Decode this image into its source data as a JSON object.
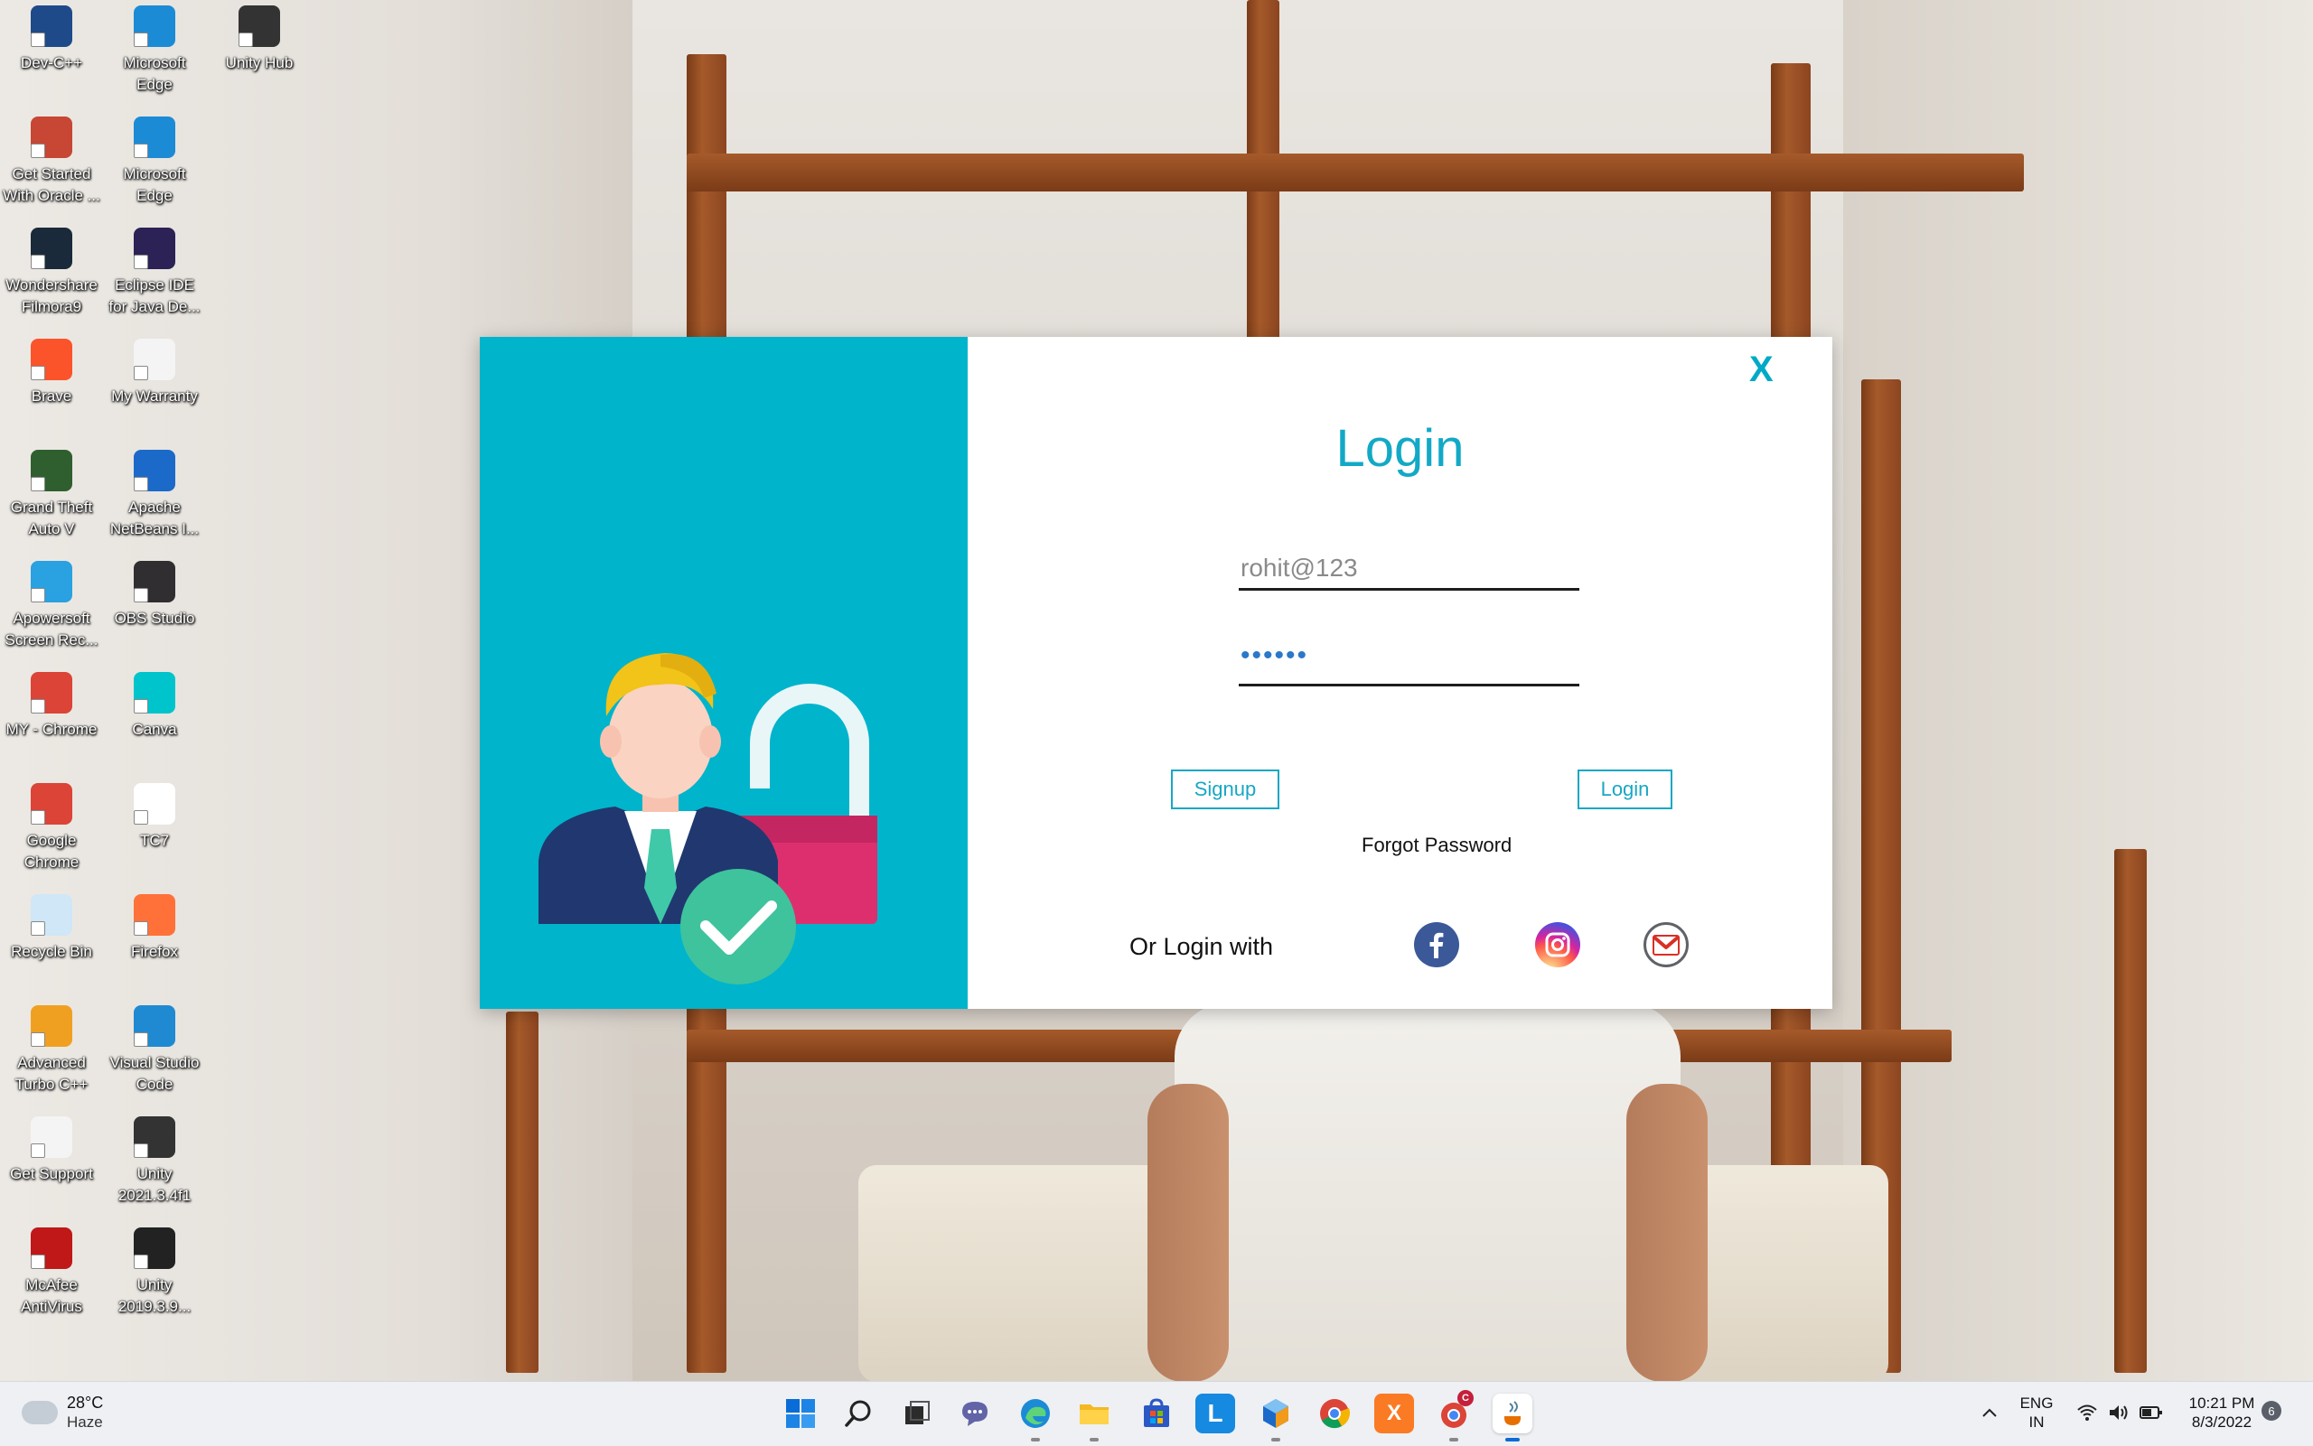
{
  "desktop": {
    "icons": [
      {
        "label": "Dev-C++",
        "icon": "devcpp-icon",
        "color": "#1f4a8a"
      },
      {
        "label": "Microsoft Edge",
        "icon": "edge-icon",
        "color": "#1b8bd6"
      },
      {
        "label": "Unity Hub",
        "icon": "unity-hub-icon",
        "color": "#333333"
      },
      {
        "label": "Get Started With Oracle ...",
        "icon": "oracle-db-icon",
        "color": "#c74634"
      },
      {
        "label": "Microsoft Edge",
        "icon": "edge-icon",
        "color": "#1b8bd6"
      },
      {
        "label": "Wondershare Filmora9",
        "icon": "filmora-icon",
        "color": "#1b2a3a"
      },
      {
        "label": "Eclipse IDE for Java De...",
        "icon": "eclipse-icon",
        "color": "#2c2255"
      },
      {
        "label": "Brave",
        "icon": "brave-icon",
        "color": "#fb542b"
      },
      {
        "label": "My Warranty",
        "icon": "document-icon",
        "color": "#f4f4f4"
      },
      {
        "label": "Grand Theft Auto V",
        "icon": "gta-icon",
        "color": "#2f5f2f"
      },
      {
        "label": "Apache NetBeans I...",
        "icon": "netbeans-icon",
        "color": "#1b6ac9"
      },
      {
        "label": "Apowersoft Screen Rec...",
        "icon": "apowersoft-icon",
        "color": "#2aa1e0"
      },
      {
        "label": "OBS Studio",
        "icon": "obs-icon",
        "color": "#302e31"
      },
      {
        "label": "MY - Chrome",
        "icon": "chrome-profile-icon",
        "color": "#db4437"
      },
      {
        "label": "Canva",
        "icon": "canva-icon",
        "color": "#00c4cc"
      },
      {
        "label": "Google Chrome",
        "icon": "chrome-icon",
        "color": "#db4437"
      },
      {
        "label": "TC7",
        "icon": "tc7-icon",
        "color": "#ffffff"
      },
      {
        "label": "Recycle Bin",
        "icon": "recycle-bin-icon",
        "color": "#cfe7f7"
      },
      {
        "label": "Firefox",
        "icon": "firefox-icon",
        "color": "#ff7139"
      },
      {
        "label": "Advanced Turbo C++",
        "icon": "turbo-cpp-icon",
        "color": "#f0a020"
      },
      {
        "label": "Visual Studio Code",
        "icon": "vscode-icon",
        "color": "#1f8ad2"
      },
      {
        "label": "Get Support",
        "icon": "document-icon",
        "color": "#f4f4f4"
      },
      {
        "label": "Unity 2021.3.4f1",
        "icon": "unity-icon",
        "color": "#333333"
      },
      {
        "label": "McAfee AntiVirus",
        "icon": "mcafee-icon",
        "color": "#c01818"
      },
      {
        "label": "Unity 2019.3.9...",
        "icon": "unity-icon",
        "color": "#222222"
      }
    ]
  },
  "dialog": {
    "close_label": "X",
    "title": "Login",
    "username_value": "rohit@123",
    "password_value": "••••••",
    "signup_label": "Signup",
    "login_label": "Login",
    "forgot_label": "Forgot Password",
    "or_login_label": "Or Login with",
    "accent_color": "#00b4cc"
  },
  "taskbar": {
    "weather_temp": "28°C",
    "weather_desc": "Haze",
    "lang_line1": "ENG",
    "lang_line2": "IN",
    "time": "10:21 PM",
    "date": "8/3/2022",
    "notification_count": "6",
    "apps": [
      {
        "name": "start-button",
        "icon": "windows-start-icon"
      },
      {
        "name": "search-button",
        "icon": "search-icon"
      },
      {
        "name": "task-view-button",
        "icon": "task-view-icon"
      },
      {
        "name": "teams-chat",
        "icon": "chat-icon"
      },
      {
        "name": "edge",
        "icon": "edge-icon"
      },
      {
        "name": "file-explorer",
        "icon": "folder-icon"
      },
      {
        "name": "microsoft-store",
        "icon": "store-icon"
      },
      {
        "name": "l-app",
        "icon": "l-app-icon"
      },
      {
        "name": "netbeans",
        "icon": "netbeans-icon"
      },
      {
        "name": "chrome",
        "icon": "chrome-icon"
      },
      {
        "name": "xampp",
        "icon": "xampp-icon"
      },
      {
        "name": "chrome-profile",
        "icon": "chrome-profile-icon"
      },
      {
        "name": "java",
        "icon": "java-icon"
      }
    ],
    "profile_badge": "C"
  }
}
